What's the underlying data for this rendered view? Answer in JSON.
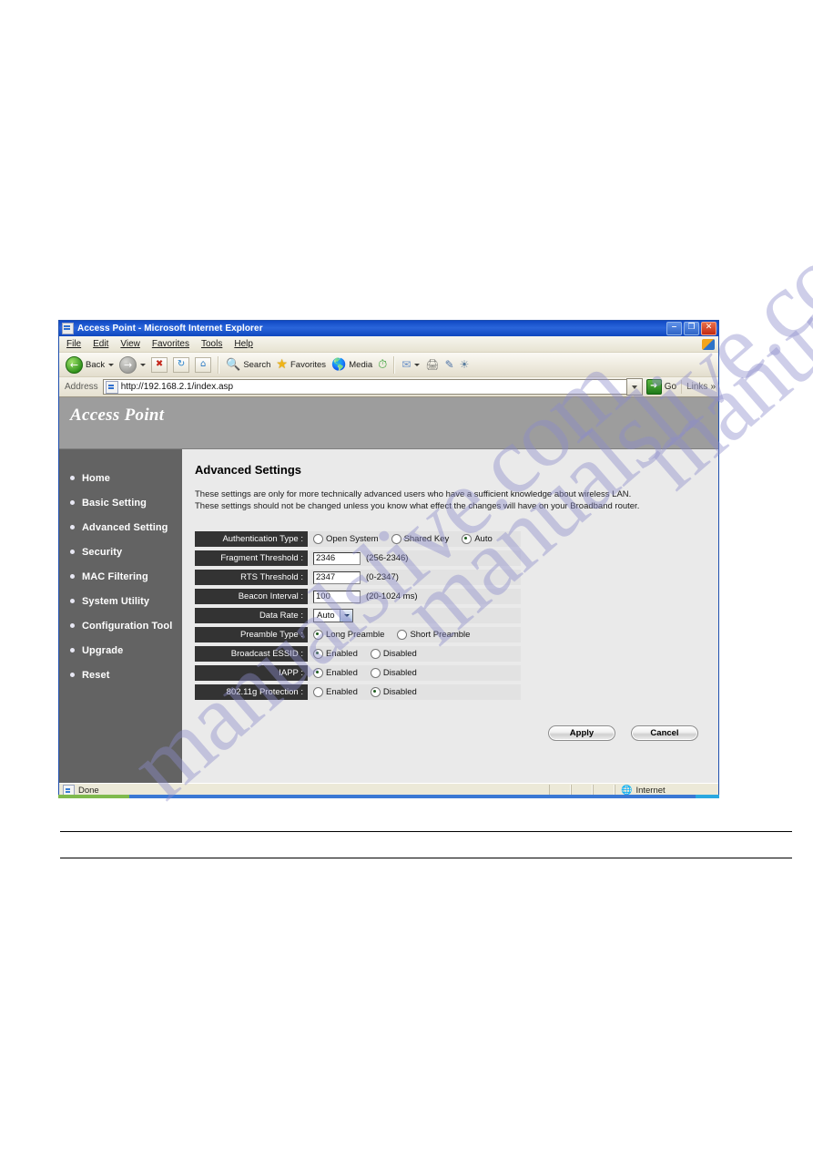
{
  "watermark": {
    "text": "manualslive.com"
  },
  "browser": {
    "titlebar": {
      "title": "Access Point - Microsoft Internet Explorer",
      "icon": "ie-page-icon",
      "minimize": "–",
      "restore": "❐",
      "close": "✕"
    },
    "menubar": {
      "items": [
        "File",
        "Edit",
        "View",
        "Favorites",
        "Tools",
        "Help"
      ]
    },
    "toolbar": {
      "back": "Back",
      "forward": "",
      "search": "Search",
      "favorites": "Favorites",
      "media": "Media",
      "icons": {
        "back": "back-arrow-icon",
        "forward": "forward-arrow-icon",
        "stop": "stop-icon",
        "refresh": "refresh-icon",
        "home": "home-icon",
        "search": "magnifier-icon",
        "favorites": "star-icon",
        "media": "media-globe-icon",
        "history": "history-clock-icon",
        "mail": "mail-icon",
        "print": "printer-icon",
        "edit": "edit-icon",
        "messenger": "messenger-icon"
      }
    },
    "addressbar": {
      "label": "Address",
      "url": "http://192.168.2.1/index.asp",
      "placeholder": "Address",
      "go": "Go",
      "links": "Links",
      "chevron": "»"
    },
    "statusbar": {
      "status": "Done",
      "zone": "Internet"
    }
  },
  "page": {
    "banner_title": "Access Point",
    "sidebar": {
      "items": [
        {
          "label": "Home"
        },
        {
          "label": "Basic Setting"
        },
        {
          "label": "Advanced Setting"
        },
        {
          "label": "Security"
        },
        {
          "label": "MAC Filtering"
        },
        {
          "label": "System Utility"
        },
        {
          "label": "Configuration Tool"
        },
        {
          "label": "Upgrade"
        },
        {
          "label": "Reset"
        }
      ]
    },
    "content": {
      "title": "Advanced Settings",
      "description": "These settings are only for more technically advanced users who have a sufficient knowledge about wireless LAN. These settings should not be changed unless you know what effect the changes will have on your Broadband router.",
      "rows": [
        {
          "label": "Authentication Type :",
          "type": "radio",
          "options": [
            {
              "text": "Open System",
              "selected": false
            },
            {
              "text": "Shared Key",
              "selected": false
            },
            {
              "text": "Auto",
              "selected": true
            }
          ]
        },
        {
          "label": "Fragment Threshold :",
          "type": "text",
          "value": "2346",
          "hint": "(256-2346)"
        },
        {
          "label": "RTS Threshold :",
          "type": "text",
          "value": "2347",
          "hint": "(0-2347)"
        },
        {
          "label": "Beacon Interval :",
          "type": "text",
          "value": "100",
          "hint": "(20-1024 ms)"
        },
        {
          "label": "Data Rate :",
          "type": "select",
          "value": "Auto",
          "hint": ""
        },
        {
          "label": "Preamble Type :",
          "type": "radio",
          "options": [
            {
              "text": "Long Preamble",
              "selected": true
            },
            {
              "text": "Short Preamble",
              "selected": false
            }
          ]
        },
        {
          "label": "Broadcast ESSID :",
          "type": "radio",
          "options": [
            {
              "text": "Enabled",
              "selected": true
            },
            {
              "text": "Disabled",
              "selected": false
            }
          ]
        },
        {
          "label": "IAPP :",
          "type": "radio",
          "options": [
            {
              "text": "Enabled",
              "selected": true
            },
            {
              "text": "Disabled",
              "selected": false
            }
          ]
        },
        {
          "label": "802.11g Protection :",
          "type": "radio",
          "options": [
            {
              "text": "Enabled",
              "selected": false
            },
            {
              "text": "Disabled",
              "selected": true
            }
          ]
        }
      ],
      "buttons": {
        "apply": "Apply",
        "cancel": "Cancel"
      }
    }
  },
  "colors": {
    "banner_bg": "#9d9d9d",
    "sidebar_bg": "#636363",
    "content_bg": "#eaeaea",
    "label_bg": "#333333",
    "value_bg": "#e2e2e2",
    "titlebar_blue": "#1049c4",
    "watermark": "#8c8ccb"
  }
}
